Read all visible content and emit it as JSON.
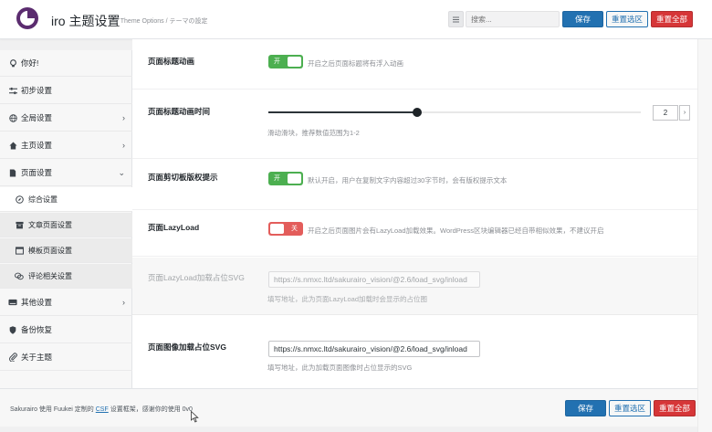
{
  "header": {
    "title": "iro 主题设置",
    "subtitle": "/ Theme Options / テーマの設定",
    "search_placeholder": "搜索...",
    "save_label": "保存",
    "reset_section_label": "重置选区",
    "reset_all_label": "重置全部"
  },
  "sidebar": {
    "items": [
      {
        "label": "你好!",
        "icon": "lightbulb-icon"
      },
      {
        "label": "初步设置",
        "icon": "sliders-icon"
      },
      {
        "label": "全局设置",
        "icon": "globe-icon",
        "chevron": "›"
      },
      {
        "label": "主页设置",
        "icon": "home-icon",
        "chevron": "›"
      },
      {
        "label": "页面设置",
        "icon": "file-icon",
        "chevron": "⌄"
      },
      {
        "label": "综合设置",
        "icon": "compass-icon"
      },
      {
        "label": "文章页面设置",
        "icon": "archive-icon"
      },
      {
        "label": "模板页面设置",
        "icon": "window-icon"
      },
      {
        "label": "评论相关设置",
        "icon": "comments-icon"
      },
      {
        "label": "其他设置",
        "icon": "keyboard-icon",
        "chevron": "›"
      },
      {
        "label": "备份恢复",
        "icon": "shield-icon"
      },
      {
        "label": "关于主题",
        "icon": "paperclip-icon"
      }
    ]
  },
  "settings": {
    "title_anim": {
      "label": "页面标题动画",
      "toggle": "开",
      "desc": "开启之后页面标题将有浮入动画"
    },
    "title_anim_time": {
      "label": "页面标题动画时间",
      "value": "2",
      "step": "›",
      "desc": "滑动滑块，推荐数值范围为1-2",
      "slider_fraction": 0.4
    },
    "clipboard": {
      "label": "页面剪切板版权提示",
      "toggle": "开",
      "desc": "默认开启，用户在复制文字内容超过30字节时，会有版权提示文本"
    },
    "lazyload": {
      "label": "页面LazyLoad",
      "toggle": "关",
      "desc": "开启之后页面图片会有LazyLoad加载效果。WordPress区块编辑器已经自带相似效果，不建议开启"
    },
    "lazyload_svg": {
      "label": "页面LazyLoad加载占位SVG",
      "value": "https://s.nmxc.ltd/sakurairo_vision/@2.6/load_svg/inload",
      "desc": "填写地址，此为页面LazyLoad加载时会显示的占位图"
    },
    "image_svg": {
      "label": "页面图像加载占位SVG",
      "value": "https://s.nmxc.ltd/sakurairo_vision/@2.6/load_svg/inload",
      "desc": "填写地址，此为加载页面图像时占位显示的SVG"
    }
  },
  "footer": {
    "text_before": "Sakurairo 使用 Fuukei 定制的 ",
    "link": "CSF",
    "text_after": " 设置框架，感谢你的使用 0v0",
    "save_label": "保存",
    "reset_section_label": "重置选区",
    "reset_all_label": "重置全部"
  },
  "colors": {
    "primary": "#2271b1",
    "danger": "#d63638",
    "toggle_on": "#4caf50",
    "toggle_off": "#e35d5b",
    "logo": "#5b2c6f"
  }
}
